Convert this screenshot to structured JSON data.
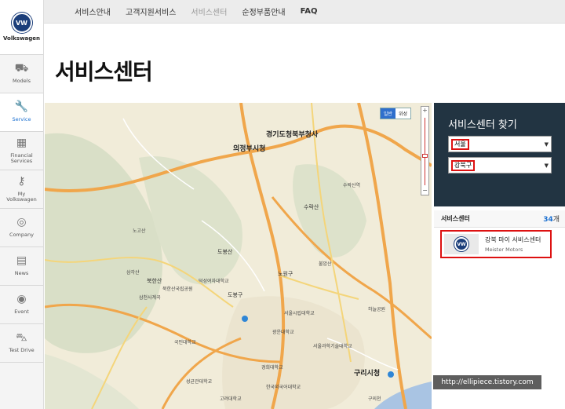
{
  "brand": {
    "logo_text": "Volkswagen"
  },
  "sidebar": {
    "items": [
      {
        "label": "Models",
        "icon": "car-icon",
        "glyph": "⛟"
      },
      {
        "label": "Service",
        "icon": "wrench-icon",
        "glyph": "🔧"
      },
      {
        "label": "Financial\nServices",
        "icon": "calculator-icon",
        "glyph": "▦"
      },
      {
        "label": "My\nVolkswagen",
        "icon": "key-icon",
        "glyph": "⚷"
      },
      {
        "label": "Company",
        "icon": "globe-icon",
        "glyph": "◎"
      },
      {
        "label": "News",
        "icon": "news-icon",
        "glyph": "▤"
      },
      {
        "label": "Event",
        "icon": "event-icon",
        "glyph": "◉"
      },
      {
        "label": "Test Drive",
        "icon": "test-drive-icon",
        "glyph": "⛍"
      }
    ],
    "active_index": 1
  },
  "topnav": {
    "items": [
      "서비스안내",
      "고객지원서비스",
      "서비스센터",
      "순정부품안내",
      "FAQ"
    ]
  },
  "page": {
    "title": "서비스센터"
  },
  "map": {
    "type_toggle": [
      "일반",
      "위성"
    ],
    "labels": {
      "city_hall": "의정부시청",
      "gov": "경기도청북부청사",
      "guri": "구리시청",
      "mountain1": "북한산",
      "mountain2": "도봉산",
      "mountain3": "수락산",
      "mountain4": "노고산",
      "mountain5": "불암산",
      "park": "북한산국립공원",
      "dobong": "도봉구",
      "nowon": "노원구",
      "seoul": "서울시립대학교",
      "kw": "광운대학교",
      "kh": "경희대학교",
      "sw": "서울과학기술대학교",
      "sammy": "삼각산",
      "camp": "삼천사계곡",
      "dk": "덕성여자대학교",
      "km": "국민대학교",
      "sk": "성균관대학교",
      "hk": "한국외국어대학교",
      "kj": "고려대학교",
      "gk": "구의천",
      "suraksan": "수락산역",
      "haneul": "하늘공원"
    }
  },
  "finder": {
    "title": "서비스센터 찾기",
    "region": "서울",
    "district": "강북구"
  },
  "results": {
    "header": "서비스센터",
    "count": "34",
    "unit": "개",
    "items": [
      {
        "name": "강북 마이 서비스센터",
        "sub": "Meister Motors"
      }
    ]
  },
  "watermark": "http://ellipiece.tistory.com",
  "colors": {
    "accent": "#1a6fd0",
    "highlight": "#dd1111",
    "panel": "#223442"
  }
}
